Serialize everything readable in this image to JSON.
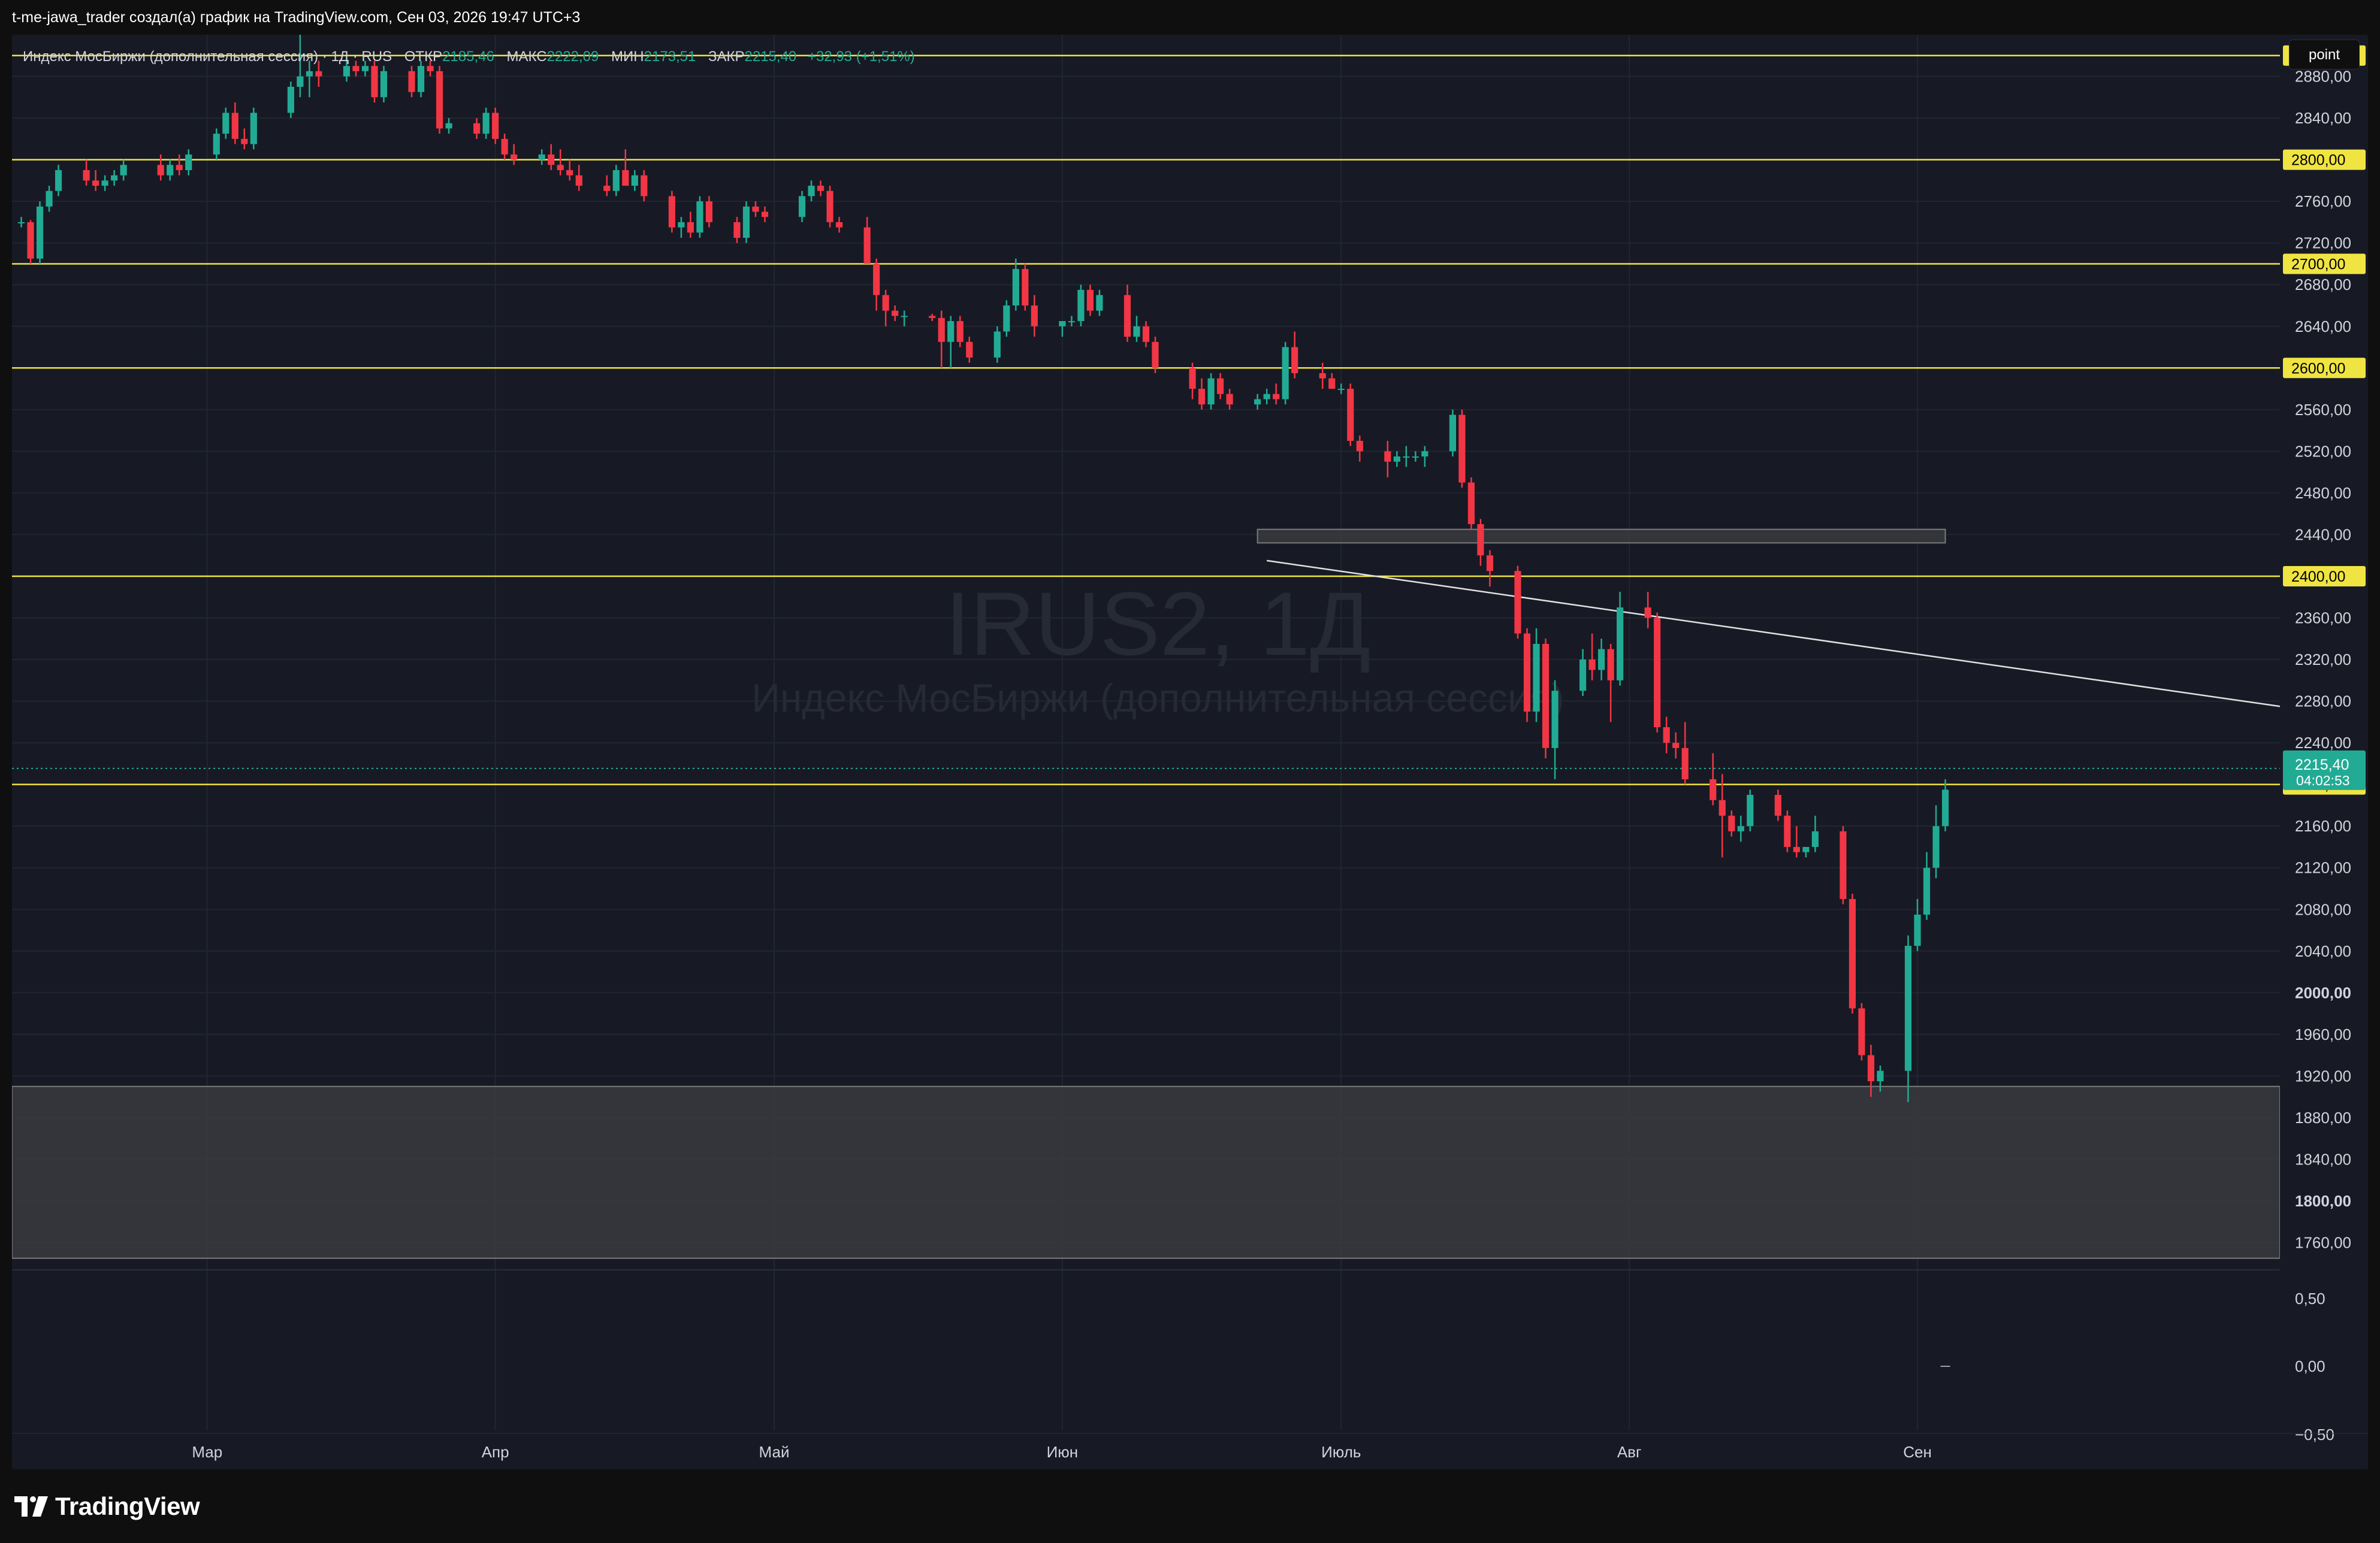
{
  "header": {
    "attribution": "t-me-jawa_trader создал(а) график на TradingView.com, Сен 03, 2026 19:47 UTC+3"
  },
  "legend": {
    "instrument": "Индекс МосБиржи (дополнительная сессия) · 1Д · RUS",
    "open_label": "ОТКР",
    "open_value": "2185,46",
    "high_label": "МАКС",
    "high_value": "2222,09",
    "low_label": "МИН",
    "low_value": "2173,51",
    "close_label": "ЗАКР",
    "close_value": "2215,40",
    "change_value": "+32,93 (+1,51%)"
  },
  "toolbar": {
    "point_label": "point"
  },
  "watermark": {
    "symbol": "IRUS2, 1Д",
    "name": "Индекс МосБиржи (дополнительная сессия)"
  },
  "footer": {
    "brand": "TradingView"
  },
  "colors": {
    "up": "#22ab94",
    "down": "#f23645",
    "level_line": "#f0e442",
    "zone": "#3a3b3f",
    "trendline": "#e0e0e0",
    "background": "#171a24",
    "axis_text": "#d1d4dc"
  },
  "chart_data": {
    "type": "candlestick",
    "price_axis": {
      "ylim": [
        1735,
        2920
      ],
      "ticks": [
        "2880,00",
        "2840,00",
        "2760,00",
        "2720,00",
        "2680,00",
        "2640,00",
        "2560,00",
        "2520,00",
        "2480,00",
        "2440,00",
        "2360,00",
        "2320,00",
        "2280,00",
        "2240,00",
        "2160,00",
        "2120,00",
        "2080,00",
        "2040,00",
        "2000,00",
        "1960,00",
        "1920,00",
        "1880,00",
        "1840,00",
        "1800,00",
        "1760,00"
      ],
      "bold_ticks": [
        "2000,00",
        "1800,00"
      ]
    },
    "horizontal_levels": [
      {
        "price": 2900,
        "label": "2900,00"
      },
      {
        "price": 2800,
        "label": "2800,00"
      },
      {
        "price": 2700,
        "label": "2700,00"
      },
      {
        "price": 2600,
        "label": "2600,00"
      },
      {
        "price": 2400,
        "label": "2400,00"
      },
      {
        "price": 2200,
        "label": "2200,00"
      }
    ],
    "last_price": {
      "price": 2215.4,
      "label": "2215,40",
      "countdown": "04:02:53"
    },
    "zones": [
      {
        "from_date": "2026-02-01",
        "to_date": "2026-10-10",
        "top": 1910,
        "bottom": 1745
      },
      {
        "from_date": "2026-06-22",
        "to_date": "2026-09-04",
        "top": 2445,
        "bottom": 2432
      }
    ],
    "trendlines": [
      {
        "from": {
          "date": "2026-06-23",
          "price": 2415
        },
        "to": {
          "date": "2026-10-10",
          "price": 2275
        }
      }
    ],
    "time_axis": [
      {
        "date": "2026-03-01",
        "label": "Мар"
      },
      {
        "date": "2026-04-01",
        "label": "Апр"
      },
      {
        "date": "2026-05-01",
        "label": "Май"
      },
      {
        "date": "2026-06-01",
        "label": "Июн"
      },
      {
        "date": "2026-07-01",
        "label": "Июль"
      },
      {
        "date": "2026-08-01",
        "label": "Авг"
      },
      {
        "date": "2026-09-01",
        "label": "Сен"
      }
    ],
    "xlim": [
      "2026-02-08",
      "2026-10-10"
    ],
    "candles": [
      [
        "2026-02-09",
        2740,
        2745,
        2735,
        2740
      ],
      [
        "2026-02-10",
        2740,
        2742,
        2700,
        2705
      ],
      [
        "2026-02-11",
        2705,
        2760,
        2700,
        2755
      ],
      [
        "2026-02-12",
        2755,
        2775,
        2750,
        2770
      ],
      [
        "2026-02-13",
        2770,
        2795,
        2765,
        2790
      ],
      [
        "2026-02-16",
        2790,
        2800,
        2775,
        2780
      ],
      [
        "2026-02-17",
        2780,
        2790,
        2770,
        2775
      ],
      [
        "2026-02-18",
        2775,
        2785,
        2770,
        2780
      ],
      [
        "2026-02-19",
        2780,
        2790,
        2775,
        2785
      ],
      [
        "2026-02-20",
        2785,
        2800,
        2780,
        2795
      ],
      [
        "2026-02-24",
        2795,
        2805,
        2780,
        2785
      ],
      [
        "2026-02-25",
        2785,
        2800,
        2780,
        2795
      ],
      [
        "2026-02-26",
        2795,
        2805,
        2785,
        2790
      ],
      [
        "2026-02-27",
        2790,
        2810,
        2785,
        2805
      ],
      [
        "2026-03-02",
        2805,
        2830,
        2800,
        2825
      ],
      [
        "2026-03-03",
        2825,
        2850,
        2820,
        2845
      ],
      [
        "2026-03-04",
        2845,
        2855,
        2815,
        2820
      ],
      [
        "2026-03-05",
        2820,
        2830,
        2810,
        2815
      ],
      [
        "2026-03-06",
        2815,
        2850,
        2810,
        2845
      ],
      [
        "2026-03-10",
        2845,
        2875,
        2840,
        2870
      ],
      [
        "2026-03-11",
        2870,
        2925,
        2860,
        2880
      ],
      [
        "2026-03-12",
        2880,
        2895,
        2860,
        2885
      ],
      [
        "2026-03-13",
        2885,
        2895,
        2870,
        2880
      ],
      [
        "2026-03-16",
        2880,
        2895,
        2875,
        2890
      ],
      [
        "2026-03-17",
        2890,
        2895,
        2880,
        2885
      ],
      [
        "2026-03-18",
        2885,
        2895,
        2880,
        2890
      ],
      [
        "2026-03-19",
        2890,
        2895,
        2855,
        2860
      ],
      [
        "2026-03-20",
        2860,
        2890,
        2855,
        2885
      ],
      [
        "2026-03-23",
        2885,
        2890,
        2860,
        2865
      ],
      [
        "2026-03-24",
        2865,
        2895,
        2860,
        2890
      ],
      [
        "2026-03-25",
        2890,
        2895,
        2880,
        2885
      ],
      [
        "2026-03-26",
        2885,
        2890,
        2825,
        2830
      ],
      [
        "2026-03-27",
        2830,
        2840,
        2825,
        2835
      ],
      [
        "2026-03-30",
        2835,
        2840,
        2820,
        2825
      ],
      [
        "2026-03-31",
        2825,
        2850,
        2820,
        2845
      ],
      [
        "2026-04-01",
        2845,
        2850,
        2815,
        2820
      ],
      [
        "2026-04-02",
        2820,
        2825,
        2800,
        2805
      ],
      [
        "2026-04-03",
        2805,
        2815,
        2795,
        2800
      ],
      [
        "2026-04-06",
        2800,
        2810,
        2795,
        2805
      ],
      [
        "2026-04-07",
        2805,
        2815,
        2790,
        2795
      ],
      [
        "2026-04-08",
        2795,
        2810,
        2785,
        2790
      ],
      [
        "2026-04-09",
        2790,
        2800,
        2780,
        2785
      ],
      [
        "2026-04-10",
        2785,
        2795,
        2770,
        2775
      ],
      [
        "2026-04-13",
        2775,
        2785,
        2765,
        2770
      ],
      [
        "2026-04-14",
        2770,
        2795,
        2765,
        2790
      ],
      [
        "2026-04-15",
        2790,
        2810,
        2785,
        2775
      ],
      [
        "2026-04-16",
        2775,
        2790,
        2770,
        2785
      ],
      [
        "2026-04-17",
        2785,
        2790,
        2760,
        2765
      ],
      [
        "2026-04-20",
        2765,
        2770,
        2730,
        2735
      ],
      [
        "2026-04-21",
        2735,
        2745,
        2725,
        2740
      ],
      [
        "2026-04-22",
        2740,
        2750,
        2725,
        2730
      ],
      [
        "2026-04-23",
        2730,
        2765,
        2725,
        2760
      ],
      [
        "2026-04-24",
        2760,
        2765,
        2735,
        2740
      ],
      [
        "2026-04-27",
        2740,
        2745,
        2720,
        2725
      ],
      [
        "2026-04-28",
        2725,
        2760,
        2720,
        2755
      ],
      [
        "2026-04-29",
        2755,
        2760,
        2745,
        2750
      ],
      [
        "2026-04-30",
        2750,
        2755,
        2740,
        2745
      ],
      [
        "2026-05-04",
        2745,
        2770,
        2740,
        2765
      ],
      [
        "2026-05-05",
        2765,
        2780,
        2760,
        2775
      ],
      [
        "2026-05-06",
        2775,
        2780,
        2765,
        2770
      ],
      [
        "2026-05-07",
        2770,
        2775,
        2735,
        2740
      ],
      [
        "2026-05-08",
        2740,
        2745,
        2730,
        2735
      ],
      [
        "2026-05-11",
        2735,
        2745,
        2710,
        2700
      ],
      [
        "2026-05-12",
        2700,
        2705,
        2655,
        2670
      ],
      [
        "2026-05-13",
        2670,
        2675,
        2640,
        2655
      ],
      [
        "2026-05-14",
        2655,
        2660,
        2645,
        2650
      ],
      [
        "2026-05-15",
        2650,
        2655,
        2640,
        2650
      ],
      [
        "2026-05-18",
        2650,
        2652,
        2645,
        2648
      ],
      [
        "2026-05-19",
        2648,
        2655,
        2600,
        2625
      ],
      [
        "2026-05-20",
        2625,
        2650,
        2600,
        2645
      ],
      [
        "2026-05-21",
        2645,
        2650,
        2620,
        2625
      ],
      [
        "2026-05-22",
        2625,
        2630,
        2605,
        2610
      ],
      [
        "2026-05-25",
        2610,
        2640,
        2605,
        2635
      ],
      [
        "2026-05-26",
        2635,
        2665,
        2630,
        2660
      ],
      [
        "2026-05-27",
        2660,
        2705,
        2655,
        2695
      ],
      [
        "2026-05-28",
        2695,
        2700,
        2655,
        2660
      ],
      [
        "2026-05-29",
        2660,
        2670,
        2630,
        2640
      ],
      [
        "2026-06-01",
        2640,
        2645,
        2630,
        2645
      ],
      [
        "2026-06-02",
        2645,
        2650,
        2640,
        2645
      ],
      [
        "2026-06-03",
        2645,
        2680,
        2640,
        2675
      ],
      [
        "2026-06-04",
        2675,
        2680,
        2650,
        2655
      ],
      [
        "2026-06-05",
        2655,
        2675,
        2650,
        2670
      ],
      [
        "2026-06-08",
        2670,
        2680,
        2625,
        2630
      ],
      [
        "2026-06-09",
        2630,
        2650,
        2625,
        2640
      ],
      [
        "2026-06-10",
        2640,
        2645,
        2620,
        2625
      ],
      [
        "2026-06-11",
        2625,
        2630,
        2595,
        2600
      ],
      [
        "2026-06-15",
        2600,
        2605,
        2570,
        2580
      ],
      [
        "2026-06-16",
        2580,
        2590,
        2560,
        2565
      ],
      [
        "2026-06-17",
        2565,
        2595,
        2560,
        2590
      ],
      [
        "2026-06-18",
        2590,
        2595,
        2570,
        2575
      ],
      [
        "2026-06-19",
        2575,
        2580,
        2560,
        2565
      ],
      [
        "2026-06-22",
        2565,
        2575,
        2560,
        2570
      ],
      [
        "2026-06-23",
        2570,
        2580,
        2565,
        2575
      ],
      [
        "2026-06-24",
        2575,
        2585,
        2565,
        2570
      ],
      [
        "2026-06-25",
        2570,
        2625,
        2565,
        2620
      ],
      [
        "2026-06-26",
        2620,
        2635,
        2590,
        2595
      ],
      [
        "2026-06-29",
        2595,
        2605,
        2580,
        2590
      ],
      [
        "2026-06-30",
        2590,
        2595,
        2580,
        2580
      ],
      [
        "2026-07-01",
        2580,
        2585,
        2575,
        2580
      ],
      [
        "2026-07-02",
        2580,
        2585,
        2525,
        2530
      ],
      [
        "2026-07-03",
        2530,
        2535,
        2510,
        2520
      ],
      [
        "2026-07-06",
        2520,
        2530,
        2495,
        2510
      ],
      [
        "2026-07-07",
        2510,
        2520,
        2505,
        2515
      ],
      [
        "2026-07-08",
        2515,
        2525,
        2505,
        2515
      ],
      [
        "2026-07-09",
        2515,
        2520,
        2510,
        2515
      ],
      [
        "2026-07-10",
        2515,
        2525,
        2505,
        2520
      ],
      [
        "2026-07-13",
        2520,
        2560,
        2515,
        2555
      ],
      [
        "2026-07-14",
        2555,
        2560,
        2485,
        2490
      ],
      [
        "2026-07-15",
        2490,
        2495,
        2445,
        2450
      ],
      [
        "2026-07-16",
        2450,
        2455,
        2410,
        2420
      ],
      [
        "2026-07-17",
        2420,
        2425,
        2390,
        2405
      ],
      [
        "2026-07-20",
        2405,
        2410,
        2340,
        2345
      ],
      [
        "2026-07-21",
        2345,
        2350,
        2260,
        2270
      ],
      [
        "2026-07-22",
        2270,
        2350,
        2260,
        2335
      ],
      [
        "2026-07-23",
        2335,
        2340,
        2225,
        2235
      ],
      [
        "2026-07-24",
        2235,
        2300,
        2205,
        2290
      ],
      [
        "2026-07-27",
        2290,
        2330,
        2285,
        2320
      ],
      [
        "2026-07-28",
        2320,
        2345,
        2300,
        2310
      ],
      [
        "2026-07-29",
        2310,
        2340,
        2300,
        2330
      ],
      [
        "2026-07-30",
        2330,
        2335,
        2260,
        2300
      ],
      [
        "2026-07-31",
        2300,
        2385,
        2295,
        2370
      ],
      [
        "2026-08-03",
        2370,
        2385,
        2350,
        2360
      ],
      [
        "2026-08-04",
        2360,
        2365,
        2250,
        2255
      ],
      [
        "2026-08-05",
        2255,
        2265,
        2230,
        2240
      ],
      [
        "2026-08-06",
        2240,
        2250,
        2225,
        2235
      ],
      [
        "2026-08-07",
        2235,
        2260,
        2200,
        2205
      ],
      [
        "2026-08-10",
        2205,
        2230,
        2180,
        2185
      ],
      [
        "2026-08-11",
        2185,
        2210,
        2130,
        2170
      ],
      [
        "2026-08-12",
        2170,
        2175,
        2150,
        2155
      ],
      [
        "2026-08-13",
        2155,
        2170,
        2145,
        2160
      ],
      [
        "2026-08-14",
        2160,
        2195,
        2155,
        2190
      ],
      [
        "2026-08-17",
        2190,
        2195,
        2165,
        2170
      ],
      [
        "2026-08-18",
        2170,
        2175,
        2135,
        2140
      ],
      [
        "2026-08-19",
        2140,
        2160,
        2130,
        2135
      ],
      [
        "2026-08-20",
        2135,
        2140,
        2130,
        2140
      ],
      [
        "2026-08-21",
        2140,
        2170,
        2135,
        2155
      ],
      [
        "2026-08-24",
        2155,
        2160,
        2085,
        2090
      ],
      [
        "2026-08-25",
        2090,
        2095,
        1980,
        1985
      ],
      [
        "2026-08-26",
        1985,
        1990,
        1935,
        1940
      ],
      [
        "2026-08-27",
        1940,
        1950,
        1900,
        1915
      ],
      [
        "2026-08-28",
        1915,
        1930,
        1905,
        1925
      ],
      [
        "2026-08-31",
        1925,
        2055,
        1895,
        2045
      ],
      [
        "2026-09-01",
        2045,
        2090,
        2040,
        2075
      ],
      [
        "2026-09-02",
        2075,
        2135,
        2070,
        2120
      ],
      [
        "2026-09-03",
        2120,
        2180,
        2110,
        2160
      ],
      [
        "2026-09-04",
        2160,
        2205,
        2155,
        2195
      ]
    ]
  }
}
